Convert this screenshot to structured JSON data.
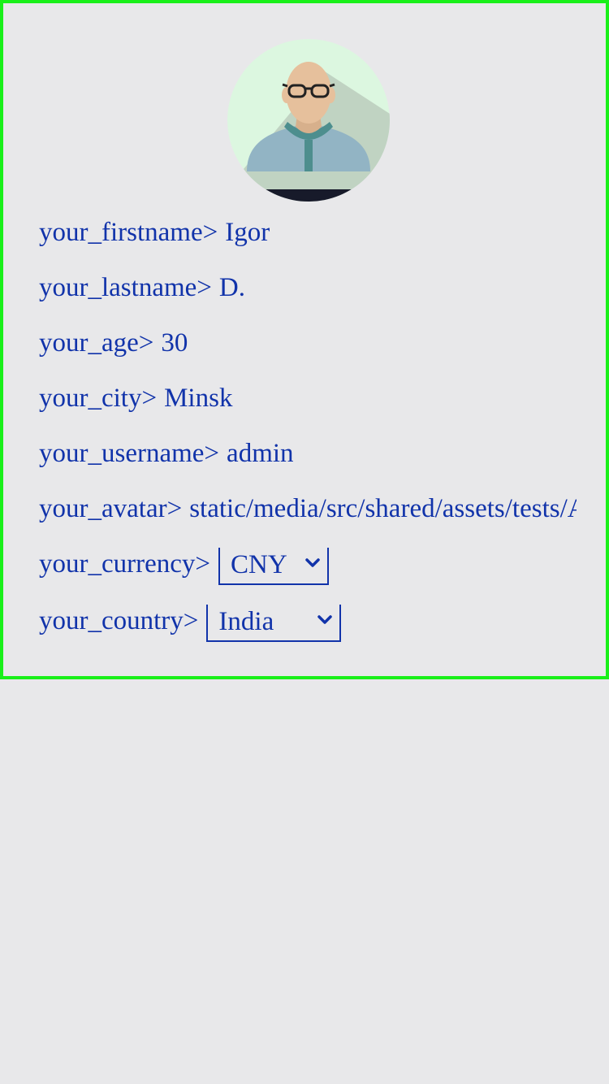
{
  "profile": {
    "avatar_icon": "user-avatar-bald-glasses",
    "fields": [
      {
        "label": "your_firstname>",
        "value": "Igor"
      },
      {
        "label": "your_lastname>",
        "value": "D."
      },
      {
        "label": "your_age>",
        "value": "30"
      },
      {
        "label": "your_city>",
        "value": "Minsk"
      },
      {
        "label": "your_username>",
        "value": "admin"
      },
      {
        "label": "your_avatar>",
        "value": "static/media/src/shared/assets/tests/Av"
      }
    ],
    "currency": {
      "label": "your_currency>",
      "selected": "CNY"
    },
    "country": {
      "label": "your_country>",
      "selected": "India"
    }
  },
  "colors": {
    "border": "#19f019",
    "text": "#1133aa",
    "background": "#e8e8ea"
  }
}
